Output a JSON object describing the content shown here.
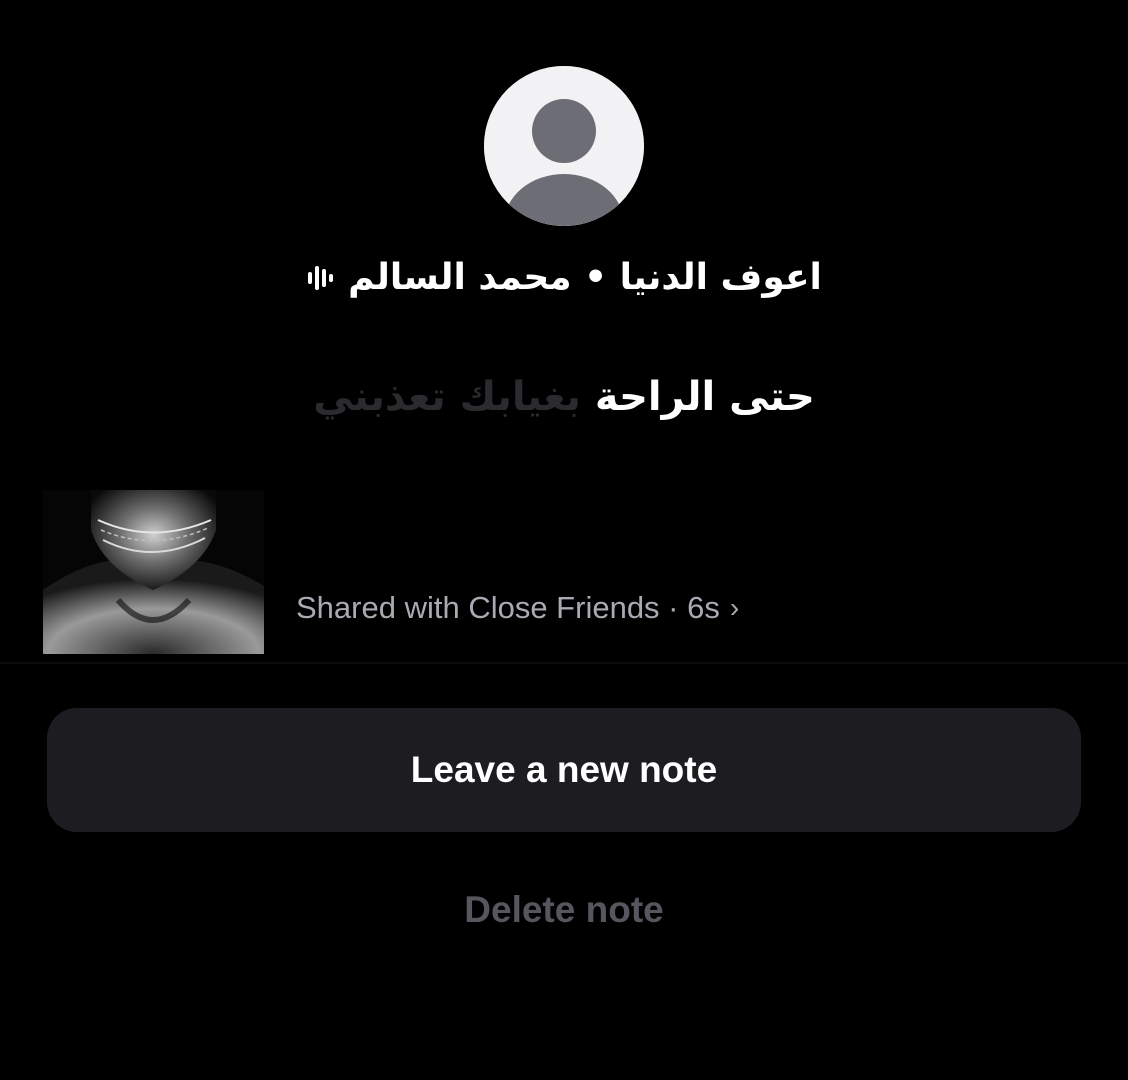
{
  "profile": {
    "avatar_icon": "default-avatar-icon"
  },
  "music": {
    "icon": "audio-waveform-icon",
    "label": "اعوف الدنيا • محمد السالم"
  },
  "lyrics": {
    "active": "حتى الراحة",
    "upcoming": "بغيابك تعذبني"
  },
  "note_meta": {
    "shared_text": "Shared with Close Friends · 6s",
    "chevron": "›"
  },
  "actions": {
    "leave_label": "Leave a new note",
    "delete_label": "Delete note"
  },
  "colors": {
    "background": "#000000",
    "button_bg": "#1d1d21",
    "meta_text": "#a9aab2",
    "delete_text": "#55565e"
  }
}
